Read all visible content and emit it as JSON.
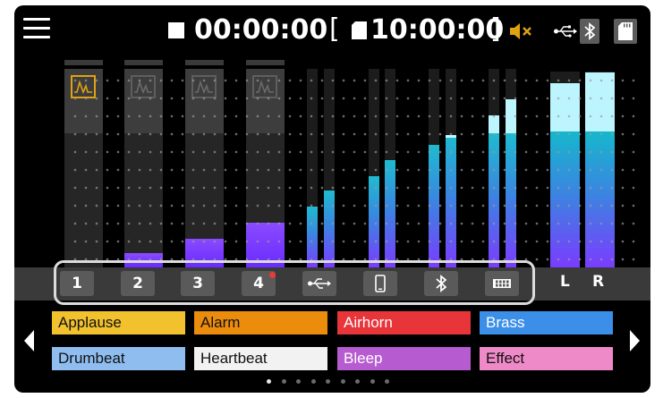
{
  "status_bar": {
    "elapsed_time": "00:00:00",
    "remaining_time": "10:00:00",
    "bracket_open": "[",
    "bracket_close": "]"
  },
  "channels": [
    {
      "label": "1",
      "fill_level": 0.0,
      "effect_active": true
    },
    {
      "label": "2",
      "fill_level": 0.12,
      "effect_active": false
    },
    {
      "label": "3",
      "fill_level": 0.23,
      "effect_active": false
    },
    {
      "label": "4",
      "fill_level": 0.34,
      "effect_active": false,
      "alert_dot": true
    },
    {
      "icon": "usb-icon"
    },
    {
      "icon": "phone-icon"
    },
    {
      "icon": "bluetooth-icon"
    },
    {
      "icon": "sound-pad-icon"
    }
  ],
  "master": {
    "left_label": "L",
    "right_label": "R"
  },
  "pads": [
    {
      "label": "Applause",
      "color": "#f2c12e",
      "text_color": "#111111"
    },
    {
      "label": "Alarm",
      "color": "#ec8c0c",
      "text_color": "#111111"
    },
    {
      "label": "Airhorn",
      "color": "#e8353a",
      "text_color": "#ffffff"
    },
    {
      "label": "Brass",
      "color": "#3b8fe8",
      "text_color": "#ffffff"
    },
    {
      "label": "Drumbeat",
      "color": "#8fbdef",
      "text_color": "#111111"
    },
    {
      "label": "Heartbeat",
      "color": "#f2f2f2",
      "text_color": "#111111"
    },
    {
      "label": "Bleep",
      "color": "#b65bd0",
      "text_color": "#ffffff"
    },
    {
      "label": "Effect",
      "color": "#ee8ac7",
      "text_color": "#111111"
    }
  ],
  "pagination": {
    "total_pages": 9,
    "current_page": 1
  },
  "colors": {
    "accent": "#e0a20f",
    "meter_purple": "#7a3cff",
    "meter_cyan": "#1fbbd0"
  }
}
